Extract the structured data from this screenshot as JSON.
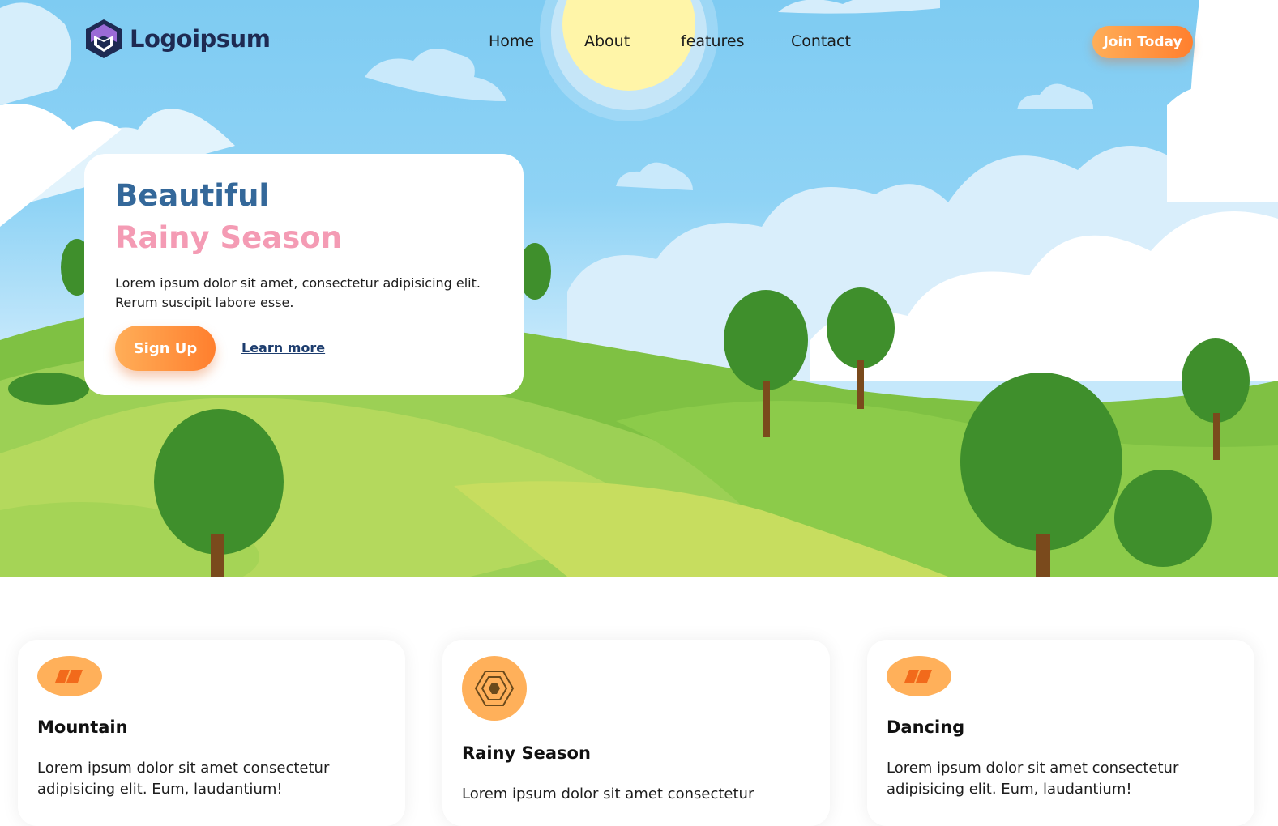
{
  "brand": {
    "name": "Logoipsum"
  },
  "nav": {
    "items": [
      "Home",
      "About",
      "features",
      "Contact"
    ],
    "cta": "Join Today"
  },
  "hero": {
    "title_line1": "Beautiful",
    "title_line2": "Rainy Season",
    "description": "Lorem ipsum dolor sit amet, consectetur adipisicing elit. Rerum suscipit labore esse.",
    "primary_button": "Sign Up",
    "secondary_link": "Learn more"
  },
  "features": [
    {
      "title": "Mountain",
      "description": "Lorem ipsum dolor sit amet consectetur adipisicing elit. Eum, laudantium!",
      "icon": "bolt-shapes-icon"
    },
    {
      "title": "Rainy Season",
      "description": "Lorem ipsum dolor sit amet consectetur",
      "icon": "hexagon-icon"
    },
    {
      "title": "Dancing",
      "description": "Lorem ipsum dolor sit amet consectetur adipisicing elit. Eum, laudantium!",
      "icon": "bolt-shapes-icon"
    }
  ],
  "colors": {
    "accent": "#ff8f3d",
    "title_blue": "#34689a",
    "title_pink": "#f49bb4",
    "icon_orange": "#ffb05a"
  }
}
